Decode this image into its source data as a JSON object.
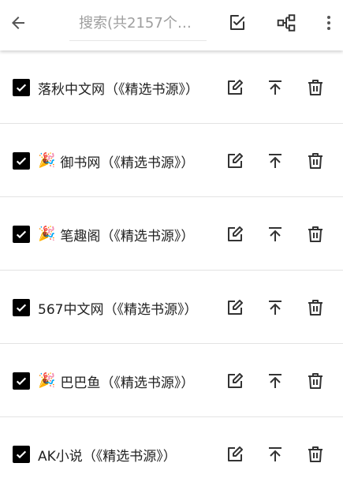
{
  "toolbar": {
    "search_placeholder": "搜索(共2157个…",
    "icons": {
      "back": "arrow-left-icon",
      "select": "edit-check-icon",
      "group": "group-tree-icon",
      "more": "more-vert-icon"
    }
  },
  "rows": [
    {
      "name": "落秋中文网（《精选书源》）",
      "checked": true,
      "emoji": ""
    },
    {
      "name": "御书网（《精选书源》）",
      "checked": true,
      "emoji": "🎉"
    },
    {
      "name": "笔趣阁（《精选书源》）",
      "checked": true,
      "emoji": "🎉"
    },
    {
      "name": "567中文网（《精选书源》）",
      "checked": true,
      "emoji": ""
    },
    {
      "name": "巴巴鱼（《精选书源》）",
      "checked": true,
      "emoji": "🎉"
    },
    {
      "name": "AK小说（《精选书源》）",
      "checked": true,
      "emoji": ""
    }
  ],
  "colors": {
    "checkbox": "#000000",
    "icon": "#333333",
    "divider": "#e3e3e3"
  }
}
